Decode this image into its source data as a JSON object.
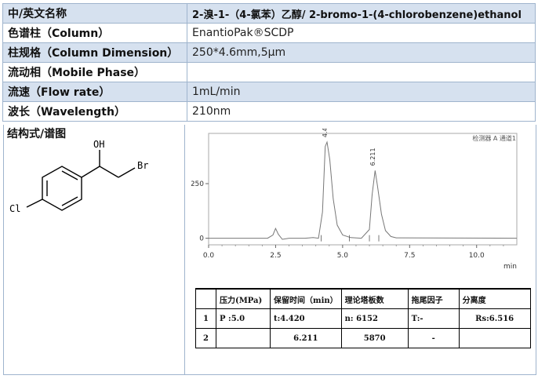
{
  "info_rows": [
    {
      "label": "中/英文名称",
      "value": "2-溴-1-（4-氯苯）乙醇/ 2-bromo-1-(4-chlorobenzene)ethanol"
    },
    {
      "label": "色谱柱（Column）",
      "value": "EnantioPak®SCDP"
    },
    {
      "label": "柱规格（Column Dimension）",
      "value": "250*4.6mm,5μm"
    },
    {
      "label": "流动相（Mobile Phase）",
      "value": ""
    },
    {
      "label": "流速（Flow rate）",
      "value": "1mL/min"
    },
    {
      "label": "波长（Wavelength）",
      "value": "210nm"
    }
  ],
  "structure": {
    "label": "结构式/谱图",
    "oh_label": "OH",
    "br_label": "Br",
    "cl_label": "Cl"
  },
  "chromatogram": {
    "detector_label": "检测器 A 通道1",
    "x_unit": "min",
    "x_ticks": [
      "0.0",
      "2.5",
      "5.0",
      "7.5",
      "10.0"
    ],
    "y_ticks": [
      "0",
      "250"
    ],
    "peak_labels": [
      "4.420",
      "6.211"
    ]
  },
  "chart_data": {
    "type": "line",
    "title": "",
    "xlabel": "min",
    "ylabel": "",
    "xlim": [
      0,
      11.5
    ],
    "ylim": [
      -30,
      480
    ],
    "series": [
      {
        "values": [
          [
            0,
            0
          ],
          [
            2.2,
            0
          ],
          [
            2.4,
            15
          ],
          [
            2.5,
            45
          ],
          [
            2.6,
            18
          ],
          [
            2.75,
            -5
          ],
          [
            3.0,
            0
          ],
          [
            3.6,
            0
          ],
          [
            3.9,
            3
          ],
          [
            4.1,
            0
          ],
          [
            4.25,
            120
          ],
          [
            4.35,
            420
          ],
          [
            4.42,
            440
          ],
          [
            4.52,
            360
          ],
          [
            4.65,
            180
          ],
          [
            4.8,
            60
          ],
          [
            5.0,
            15
          ],
          [
            5.3,
            3
          ],
          [
            5.7,
            0
          ],
          [
            6.0,
            40
          ],
          [
            6.1,
            200
          ],
          [
            6.211,
            310
          ],
          [
            6.3,
            240
          ],
          [
            6.45,
            110
          ],
          [
            6.6,
            35
          ],
          [
            6.8,
            8
          ],
          [
            7.0,
            2
          ],
          [
            11.5,
            0
          ]
        ]
      }
    ],
    "peaks": [
      {
        "retention_time": 4.42
      },
      {
        "retention_time": 6.211
      }
    ]
  },
  "results_table": {
    "headers": [
      "",
      "压力(MPa)",
      "保留时间（min）",
      "理论塔板数",
      "拖尾因子",
      "分离度"
    ],
    "rows": [
      [
        "1",
        "P :5.0",
        "t:4.420",
        "n: 6152",
        "T:-",
        "Rs:6.516"
      ],
      [
        "2",
        "",
        "6.211",
        "5870",
        "-",
        ""
      ]
    ]
  }
}
